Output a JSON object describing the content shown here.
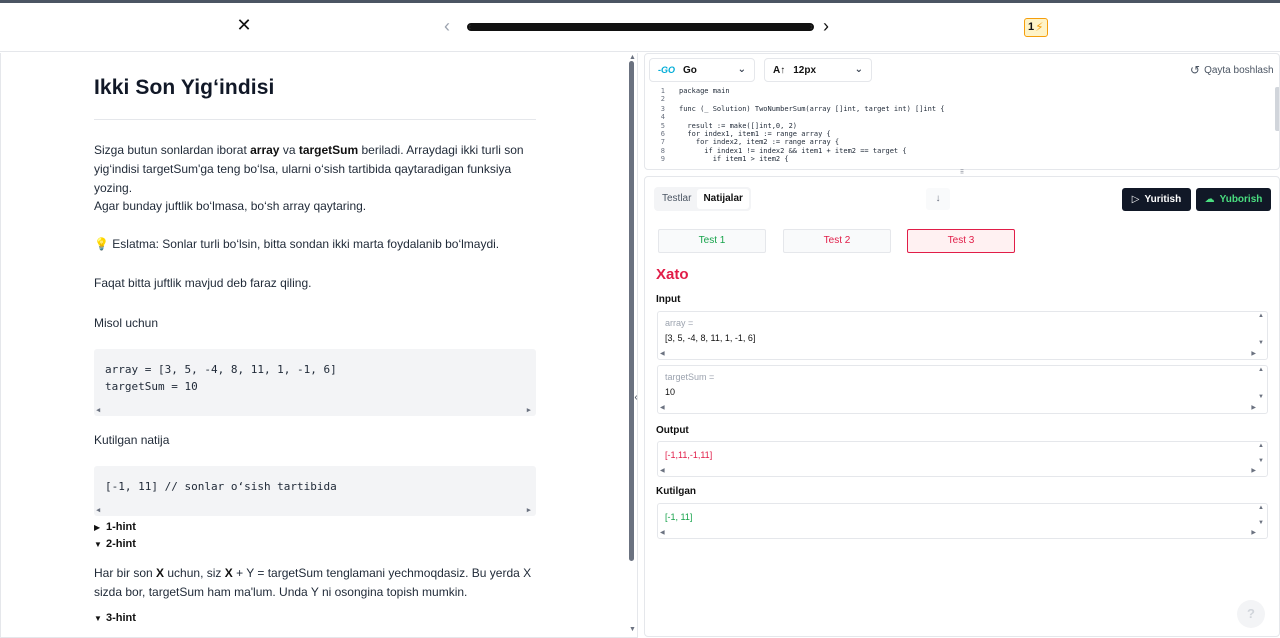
{
  "topbar": {
    "badge_count": "1",
    "progress_percent": 100
  },
  "problem": {
    "title": "Ikki Son Yig‘indisi",
    "intro_pre": "Sizga butun sonlardan iborat ",
    "intro_b1": "array",
    "intro_mid": " va ",
    "intro_b2": "targetSum",
    "intro_post": " beriladi. Arraydagi ikki turli son yig‘indisi targetSum'ga teng bo‘lsa, ularni o‘sish tartibida qaytaradigan funksiya yozing.",
    "para2": "Agar bunday juftlik bo‘lmasa, bo‘sh array qaytaring.",
    "para3": "💡 Eslatma: Sonlar turli bo‘lsin, bitta sondan ikki marta foydalanib bo‘lmaydi.",
    "para4": "Faqat bitta juftlik mavjud deb faraz qiling.",
    "example_label": "Misol uchun",
    "example_code_1": "array = [3, 5, -4, 8, 11, 1, -1, 6]",
    "example_code_2": "targetSum = 10",
    "expected_label": "Kutilgan natija",
    "expected_code": "[-1, 11] // sonlar o‘sish tartibida",
    "hint1": "1-hint",
    "hint2": "2-hint",
    "hint2_pre": "Har bir son ",
    "hint2_b1": "X",
    "hint2_mid": " uchun, siz ",
    "hint2_b2": "X",
    "hint2_post": " + Y = targetSum tenglamani yechmoqdasiz. Bu yerda X sizda bor, targetSum ham ma'lum. Unda Y ni osongina topish mumkin.",
    "hint3": "3-hint"
  },
  "editor": {
    "language": "Go",
    "go_logo": "-GO",
    "font_size": "12px",
    "reset_label": "Qayta boshlash",
    "lines": [
      {
        "n": "1",
        "t": "package main"
      },
      {
        "n": "2",
        "t": ""
      },
      {
        "n": "3",
        "t": "func (_ Solution) TwoNumberSum(array []int, target int) []int {"
      },
      {
        "n": "4",
        "t": ""
      },
      {
        "n": "5",
        "t": "  result := make([]int,0, 2)"
      },
      {
        "n": "6",
        "t": "  for index1, item1 := range array {"
      },
      {
        "n": "7",
        "t": "    for index2, item2 := range array {"
      },
      {
        "n": "8",
        "t": "      if index1 != index2 && item1 + item2 == target {"
      },
      {
        "n": "9",
        "t": "        if item1 > item2 {"
      }
    ]
  },
  "results": {
    "tab_tests": "Testlar",
    "tab_results": "Natijalar",
    "run_label": "Yuritish",
    "submit_label": "Yuborish",
    "test1": "Test 1",
    "test2": "Test 2",
    "test3": "Test 3",
    "status": "Xato",
    "input_label": "Input",
    "array_name": "array =",
    "array_value": "[3, 5, -4, 8, 11, 1, -1, 6]",
    "target_name": "targetSum =",
    "target_value": "10",
    "output_label": "Output",
    "output_value": "[-1,11,-1,11]",
    "expected_label": "Kutilgan",
    "expected_value": "[-1, 11]"
  },
  "colors": {
    "error": "#e11d48",
    "success": "#16a34a",
    "accent_dark": "#111827",
    "go_blue": "#00acd7"
  }
}
